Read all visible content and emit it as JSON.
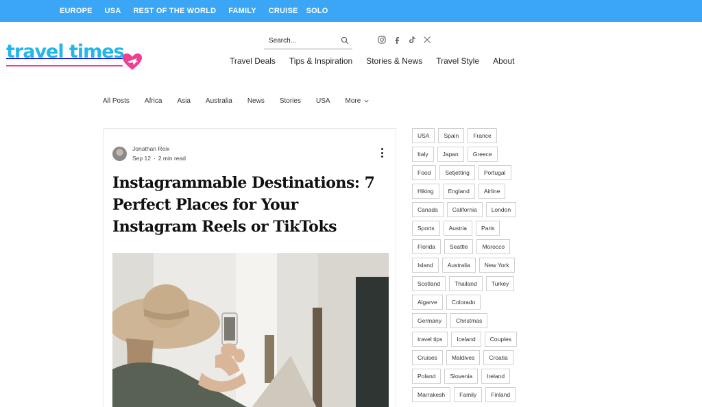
{
  "topbar": {
    "items": [
      "EUROPE",
      "USA",
      "REST OF THE WORLD",
      "FAMILY",
      "CRUISE",
      "SOLO"
    ]
  },
  "brand": {
    "logo_text": "travel times"
  },
  "search": {
    "placeholder": "Search..."
  },
  "social": {
    "icons": [
      "instagram-icon",
      "facebook-icon",
      "tiktok-icon",
      "x-icon"
    ]
  },
  "main_nav": {
    "items": [
      "Travel Deals",
      "Tips & Inspiration",
      "Stories & News",
      "Travel Style",
      "About"
    ]
  },
  "categories": {
    "items": [
      "All Posts",
      "Africa",
      "Asia",
      "Australia",
      "News",
      "Stories",
      "USA"
    ],
    "more_label": "More"
  },
  "post": {
    "author": "Jonathan Reix",
    "date": "Sep 12",
    "read_time": "2 min read",
    "title": "Instagrammable Destinations: 7 Perfect Places for Your Instagram Reels or TikToks"
  },
  "tags": [
    [
      "USA",
      "Spain",
      "France"
    ],
    [
      "Italy",
      "Japan",
      "Greece"
    ],
    [
      "Food",
      "Setjetting",
      "Portugal"
    ],
    [
      "Hiking",
      "England",
      "Airline"
    ],
    [
      "Canada",
      "California",
      "London"
    ],
    [
      "Sports",
      "Austria",
      "Paris"
    ],
    [
      "Florida",
      "Seattle",
      "Morocco"
    ],
    [
      "Island",
      "Australia",
      "New York"
    ],
    [
      "Scotland",
      "Thailand",
      "Turkey"
    ],
    [
      "Algarve",
      "Colorado"
    ],
    [
      "Germany",
      "Christmas"
    ],
    [
      "travel tips",
      "Iceland",
      "Couples"
    ],
    [
      "Cruises",
      "Maldives",
      "Croatia"
    ],
    [
      "Poland",
      "Slovenia",
      "Ireland"
    ],
    [
      "Marrakesh",
      "Family",
      "Finland"
    ]
  ],
  "colors": {
    "topbar": "#3aa6f5",
    "logo": "#21b7e8",
    "logo_accent": "#ef3f8f"
  }
}
